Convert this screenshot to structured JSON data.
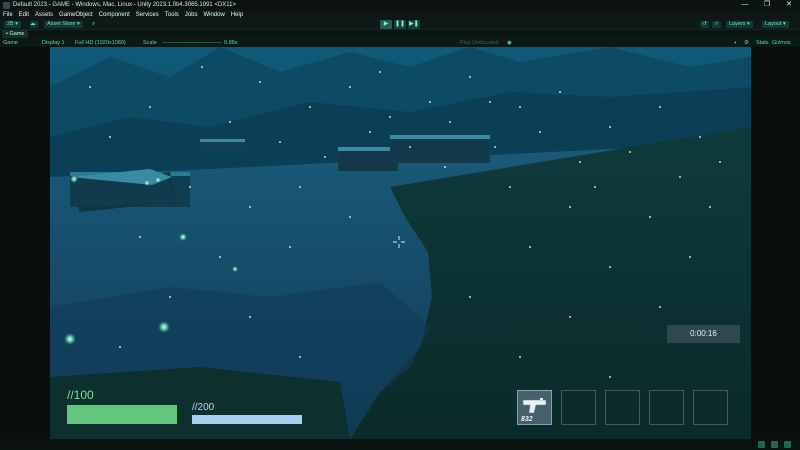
{
  "window": {
    "title": "Default 2023 - GAME - Windows, Mac, Linux - Unity 2023.1.0b4.3065.1091 <DX11>",
    "controls": {
      "minimize": "—",
      "maximize": "❐",
      "close": "✕"
    }
  },
  "menu": [
    "File",
    "Edit",
    "Assets",
    "GameObject",
    "Component",
    "Services",
    "Tools",
    "Jobs",
    "Window",
    "Help"
  ],
  "toolbar": {
    "account_label": "2B ▾",
    "asset_store_label": "Asset Store ▾",
    "play_icon": "▶",
    "pause_icon": "❚❚",
    "step_icon": "▶❚",
    "layers_label": "Layers ▾",
    "layout_label": "Layout ▾"
  },
  "tab": {
    "label": "Game"
  },
  "gamebar": {
    "mode": "Game",
    "display": "Display 1",
    "resolution": "Full HD (1920x1080)",
    "scale_label": "Scale",
    "scale_value": "0.88x",
    "play_mode": "Play Unfocused",
    "stats_label": "Stats",
    "gizmos_label": "Gizmos"
  },
  "hud": {
    "health_label": "//100",
    "health_fraction": 1.0,
    "stamina_label": "//200",
    "stamina_fraction": 1.0,
    "timer": "0:00:16",
    "ammo": "832",
    "slots": 5,
    "selected_slot": 0
  },
  "colors": {
    "health": "#62c77a",
    "stamina": "#a9cdf2",
    "accent": "#6fe2b8"
  }
}
